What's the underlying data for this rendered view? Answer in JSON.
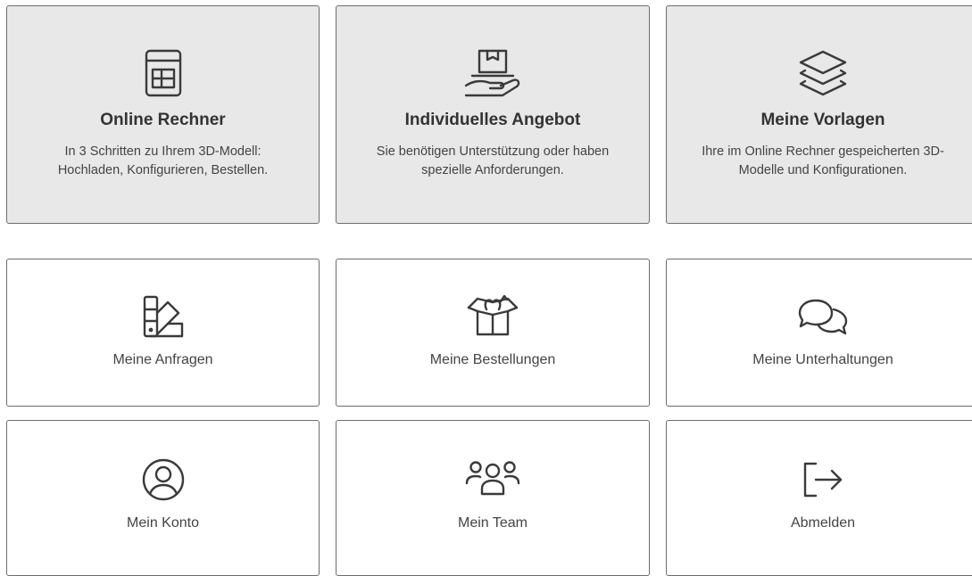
{
  "featured": [
    {
      "icon": "calculator-icon",
      "title": "Online Rechner",
      "desc1": "In 3 Schritten zu Ihrem 3D-Modell:",
      "desc2": "Hochladen, Konfigurieren, Bestellen."
    },
    {
      "icon": "hand-box-icon",
      "title": "Individuelles Angebot",
      "desc1": "Sie benötigen Unterstützung oder haben",
      "desc2": "spezielle Anforderungen."
    },
    {
      "icon": "layers-icon",
      "title": "Meine Vorlagen",
      "desc1": "Ihre im Online Rechner gespeicherten 3D-",
      "desc2": "Modelle und Konfigurationen."
    }
  ],
  "tiles": [
    {
      "icon": "swatch-icon",
      "label": "Meine Anfragen"
    },
    {
      "icon": "open-box-icon",
      "label": "Meine Bestellungen"
    },
    {
      "icon": "chat-bubbles-icon",
      "label": "Meine Unterhaltungen"
    },
    {
      "icon": "user-circle-icon",
      "label": "Mein Konto"
    },
    {
      "icon": "team-icon",
      "label": "Mein Team"
    },
    {
      "icon": "logout-icon",
      "label": "Abmelden"
    }
  ],
  "colors": {
    "featured_bg": "#e8e8e8",
    "border": "#6d6d6d",
    "text": "#333333"
  }
}
